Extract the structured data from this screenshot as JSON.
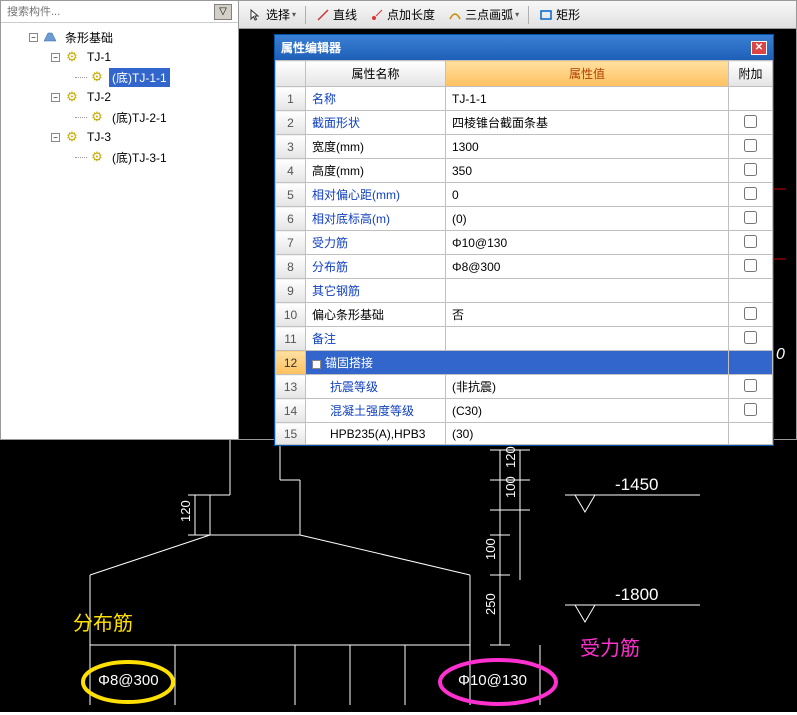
{
  "search": {
    "placeholder": "搜索构件...",
    "btn": "▽"
  },
  "tree": {
    "root": "条形基础",
    "nodes": [
      {
        "label": "TJ-1",
        "children": [
          {
            "label": "(底)TJ-1-1",
            "selected": true
          }
        ]
      },
      {
        "label": "TJ-2",
        "children": [
          {
            "label": "(底)TJ-2-1"
          }
        ]
      },
      {
        "label": "TJ-3",
        "children": [
          {
            "label": "(底)TJ-3-1"
          }
        ]
      }
    ]
  },
  "toolbar": {
    "select": "选择",
    "line": "直线",
    "pointLen": "点加长度",
    "threePointArc": "三点画弧",
    "rect": "矩形"
  },
  "dialog": {
    "title": "属性编辑器",
    "headers": {
      "name": "属性名称",
      "value": "属性值",
      "extra": "附加"
    },
    "rows": [
      {
        "n": "1",
        "name": "名称",
        "link": true,
        "value": "TJ-1-1",
        "chk": false
      },
      {
        "n": "2",
        "name": "截面形状",
        "link": true,
        "value": "四棱锥台截面条基",
        "chk": true
      },
      {
        "n": "3",
        "name": "宽度(mm)",
        "value": "1300",
        "chk": true
      },
      {
        "n": "4",
        "name": "高度(mm)",
        "value": "350",
        "chk": true
      },
      {
        "n": "5",
        "name": "相对偏心距(mm)",
        "link": true,
        "value": "0",
        "chk": true
      },
      {
        "n": "6",
        "name": "相对底标高(m)",
        "link": true,
        "value": "(0)",
        "chk": true
      },
      {
        "n": "7",
        "name": "受力筋",
        "link": true,
        "value": "Φ10@130",
        "chk": true
      },
      {
        "n": "8",
        "name": "分布筋",
        "link": true,
        "value": "Φ8@300",
        "chk": true
      },
      {
        "n": "9",
        "name": "其它钢筋",
        "link": true,
        "value": "",
        "chk": false
      },
      {
        "n": "10",
        "name": "偏心条形基础",
        "value": "否",
        "chk": true
      },
      {
        "n": "11",
        "name": "备注",
        "link": true,
        "value": "",
        "chk": true
      },
      {
        "n": "12",
        "name": "锚固搭接",
        "group": true,
        "selected": true
      },
      {
        "n": "13",
        "name": "抗震等级",
        "link": true,
        "indent": true,
        "value": "(非抗震)",
        "chk": true
      },
      {
        "n": "14",
        "name": "混凝土强度等级",
        "link": true,
        "indent": true,
        "value": "(C30)",
        "chk": true
      },
      {
        "n": "15",
        "name": "HPB235(A),HPB3",
        "indent": true,
        "value": "(30)",
        "chk": false
      }
    ]
  },
  "cad": {
    "fenbu_label": "分布筋",
    "shouli_label": "受力筋",
    "spec1": "Φ8@300",
    "spec2": "Φ10@130",
    "elev1": "-1450",
    "elev2": "-1800",
    "dim120": "120",
    "dim100": "100",
    "dim250": "250",
    "dim100b": "100",
    "zero_axis": "0"
  }
}
